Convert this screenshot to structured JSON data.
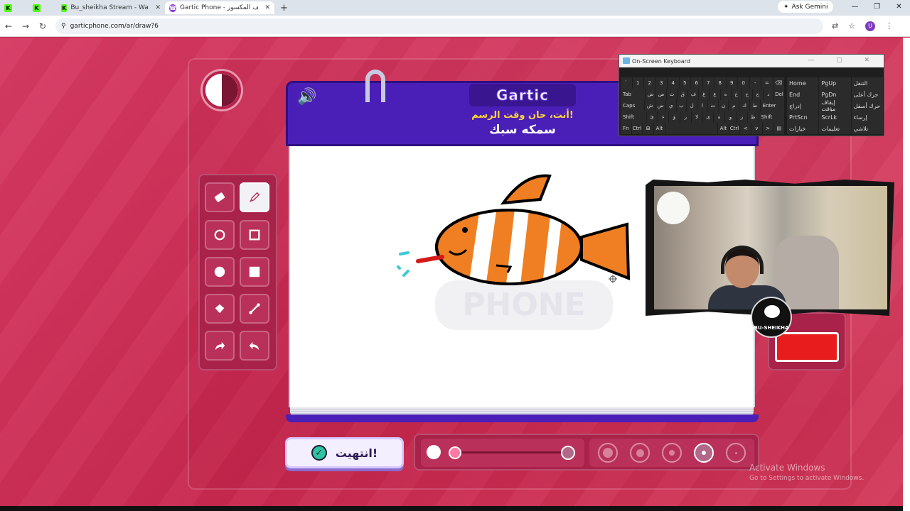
{
  "browser": {
    "tabs": [
      {
        "icon": "K",
        "label": "",
        "kind": "kick"
      },
      {
        "icon": "K",
        "label": "",
        "kind": "kick"
      },
      {
        "icon": "K",
        "label": "Bu_sheikha Stream - Watch Live",
        "kind": "kick"
      },
      {
        "icon": "☎",
        "label": "Gartic Phone - الهاتف المكسور",
        "kind": "gartic",
        "active": true
      }
    ],
    "new_tab": "+",
    "gemini_label": "Ask Gemini",
    "url": "garticphone.com/ar/draw?6",
    "profile_initial": "U"
  },
  "game": {
    "brand": "Gartic",
    "prompt_line1": "أنت، حان وقت الرسم!",
    "prompt_line2": "سمكه سبك",
    "watermark": "PHONE",
    "done_label": "انتهيت!",
    "accent": "#4a1fb8",
    "selected_color": "#e81c1c",
    "tools": [
      "eraser",
      "pencil",
      "circle-outline",
      "square-outline",
      "circle-filled",
      "square-filled",
      "bucket",
      "line",
      "redo",
      "undo"
    ],
    "selected_tool": "pencil",
    "brush_sizes": 5,
    "selected_size_index": 3
  },
  "osk": {
    "title": "On-Screen Keyboard",
    "rows": [
      [
        "`",
        "1",
        "2",
        "3",
        "4",
        "5",
        "6",
        "7",
        "8",
        "9",
        "0",
        "-",
        "=",
        "⌫"
      ],
      [
        "Tab",
        "ض",
        "ص",
        "ث",
        "ق",
        "ف",
        "غ",
        "ع",
        "ه",
        "خ",
        "ح",
        "ج",
        "د",
        "Del"
      ],
      [
        "Caps",
        "ش",
        "س",
        "ي",
        "ب",
        "ل",
        "ا",
        "ت",
        "ن",
        "م",
        "ك",
        "ط",
        "Enter"
      ],
      [
        "Shift",
        "ئ",
        "ء",
        "ؤ",
        "ر",
        "لا",
        "ى",
        "ة",
        "و",
        "ز",
        "ظ",
        "Shift"
      ],
      [
        "Fn",
        "Ctrl",
        "⊞",
        "Alt",
        "",
        "",
        "",
        "",
        "Alt",
        "Ctrl",
        "<",
        "v",
        ">",
        "▤"
      ]
    ],
    "right_keys": [
      [
        "Home",
        "PgUp",
        "التنقل"
      ],
      [
        "End",
        "PgDn",
        "حرك أعلى"
      ],
      [
        "إدراج",
        "إيقاف مؤقت",
        "حرك أسفل"
      ],
      [
        "PrtScn",
        "ScrLk",
        "إرساء"
      ],
      [
        "خيارات",
        "تعليمات",
        "تلاشي"
      ]
    ]
  },
  "webcam": {
    "logo_text": "BU-SHEIKHA"
  },
  "windows": {
    "activate_title": "Activate Windows",
    "activate_sub": "Go to Settings to activate Windows."
  }
}
